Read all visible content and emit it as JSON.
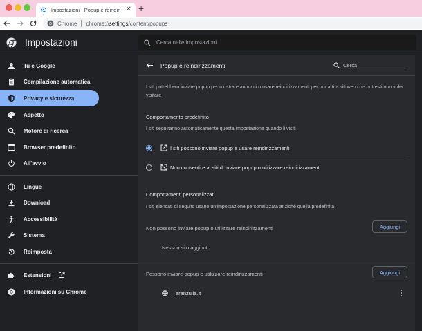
{
  "browser": {
    "tab_title": "Impostazioni - Popup e reindiri",
    "tab_close": "✕",
    "new_tab": "+",
    "omnibox_label": "Chrome",
    "url_prefix": "chrome://",
    "url_path": "settings",
    "url_suffix": "/content/popups"
  },
  "header": {
    "title": "Impostazioni",
    "search_placeholder": "Cerca nelle impostazioni"
  },
  "sidebar": {
    "items": [
      {
        "label": "Tu e Google",
        "icon": "person-icon"
      },
      {
        "label": "Compilazione automatica",
        "icon": "clipboard-icon"
      },
      {
        "label": "Privacy e sicurezza",
        "icon": "shield-icon",
        "active": true
      },
      {
        "label": "Aspetto",
        "icon": "palette-icon"
      },
      {
        "label": "Motore di ricerca",
        "icon": "search-icon"
      },
      {
        "label": "Browser predefinito",
        "icon": "browser-icon"
      },
      {
        "label": "All'avvio",
        "icon": "power-icon"
      },
      {
        "label": "Lingue",
        "icon": "globe-icon"
      },
      {
        "label": "Download",
        "icon": "download-icon"
      },
      {
        "label": "Accessibilità",
        "icon": "accessibility-icon"
      },
      {
        "label": "Sistema",
        "icon": "wrench-icon"
      },
      {
        "label": "Reimposta",
        "icon": "reset-icon"
      },
      {
        "label": "Estensioni",
        "icon": "puzzle-icon"
      },
      {
        "label": "Informazioni su Chrome",
        "icon": "chrome-icon"
      }
    ]
  },
  "page": {
    "title": "Popup e reindirizzamenti",
    "search_placeholder": "Cerca",
    "description": "I siti potrebbero inviare popup per mostrare annunci o usare reindirizzamenti per portarti a siti web che potresti non voler visitare",
    "default_title": "Comportamento predefinito",
    "default_subtitle": "I siti seguiranno automaticamente questa impostazione quando li visiti",
    "option_allow": "I siti possono inviare popup e usare reindirizzamenti",
    "option_block": "Non consentire ai siti di inviare popup o utilizzare reindirizzamenti",
    "custom_title": "Comportamenti personalizzati",
    "custom_subtitle": "I siti elencati di seguito usano un'impostazione personalizzata anziché quella predefinita",
    "blocked_label": "Non possono inviare popup o utilizzare reindirizzamenti",
    "add_label": "Aggiungi",
    "no_site": "Nessun sito aggiunto",
    "allowed_label": "Possono inviare popup e utilizzare reindirizzamenti",
    "allowed_site": "aranzulla.it"
  },
  "colors": {
    "accent": "#8ab4f8",
    "background": "#202124",
    "card": "#292a2d",
    "tabstrip": "#f6cee0"
  }
}
